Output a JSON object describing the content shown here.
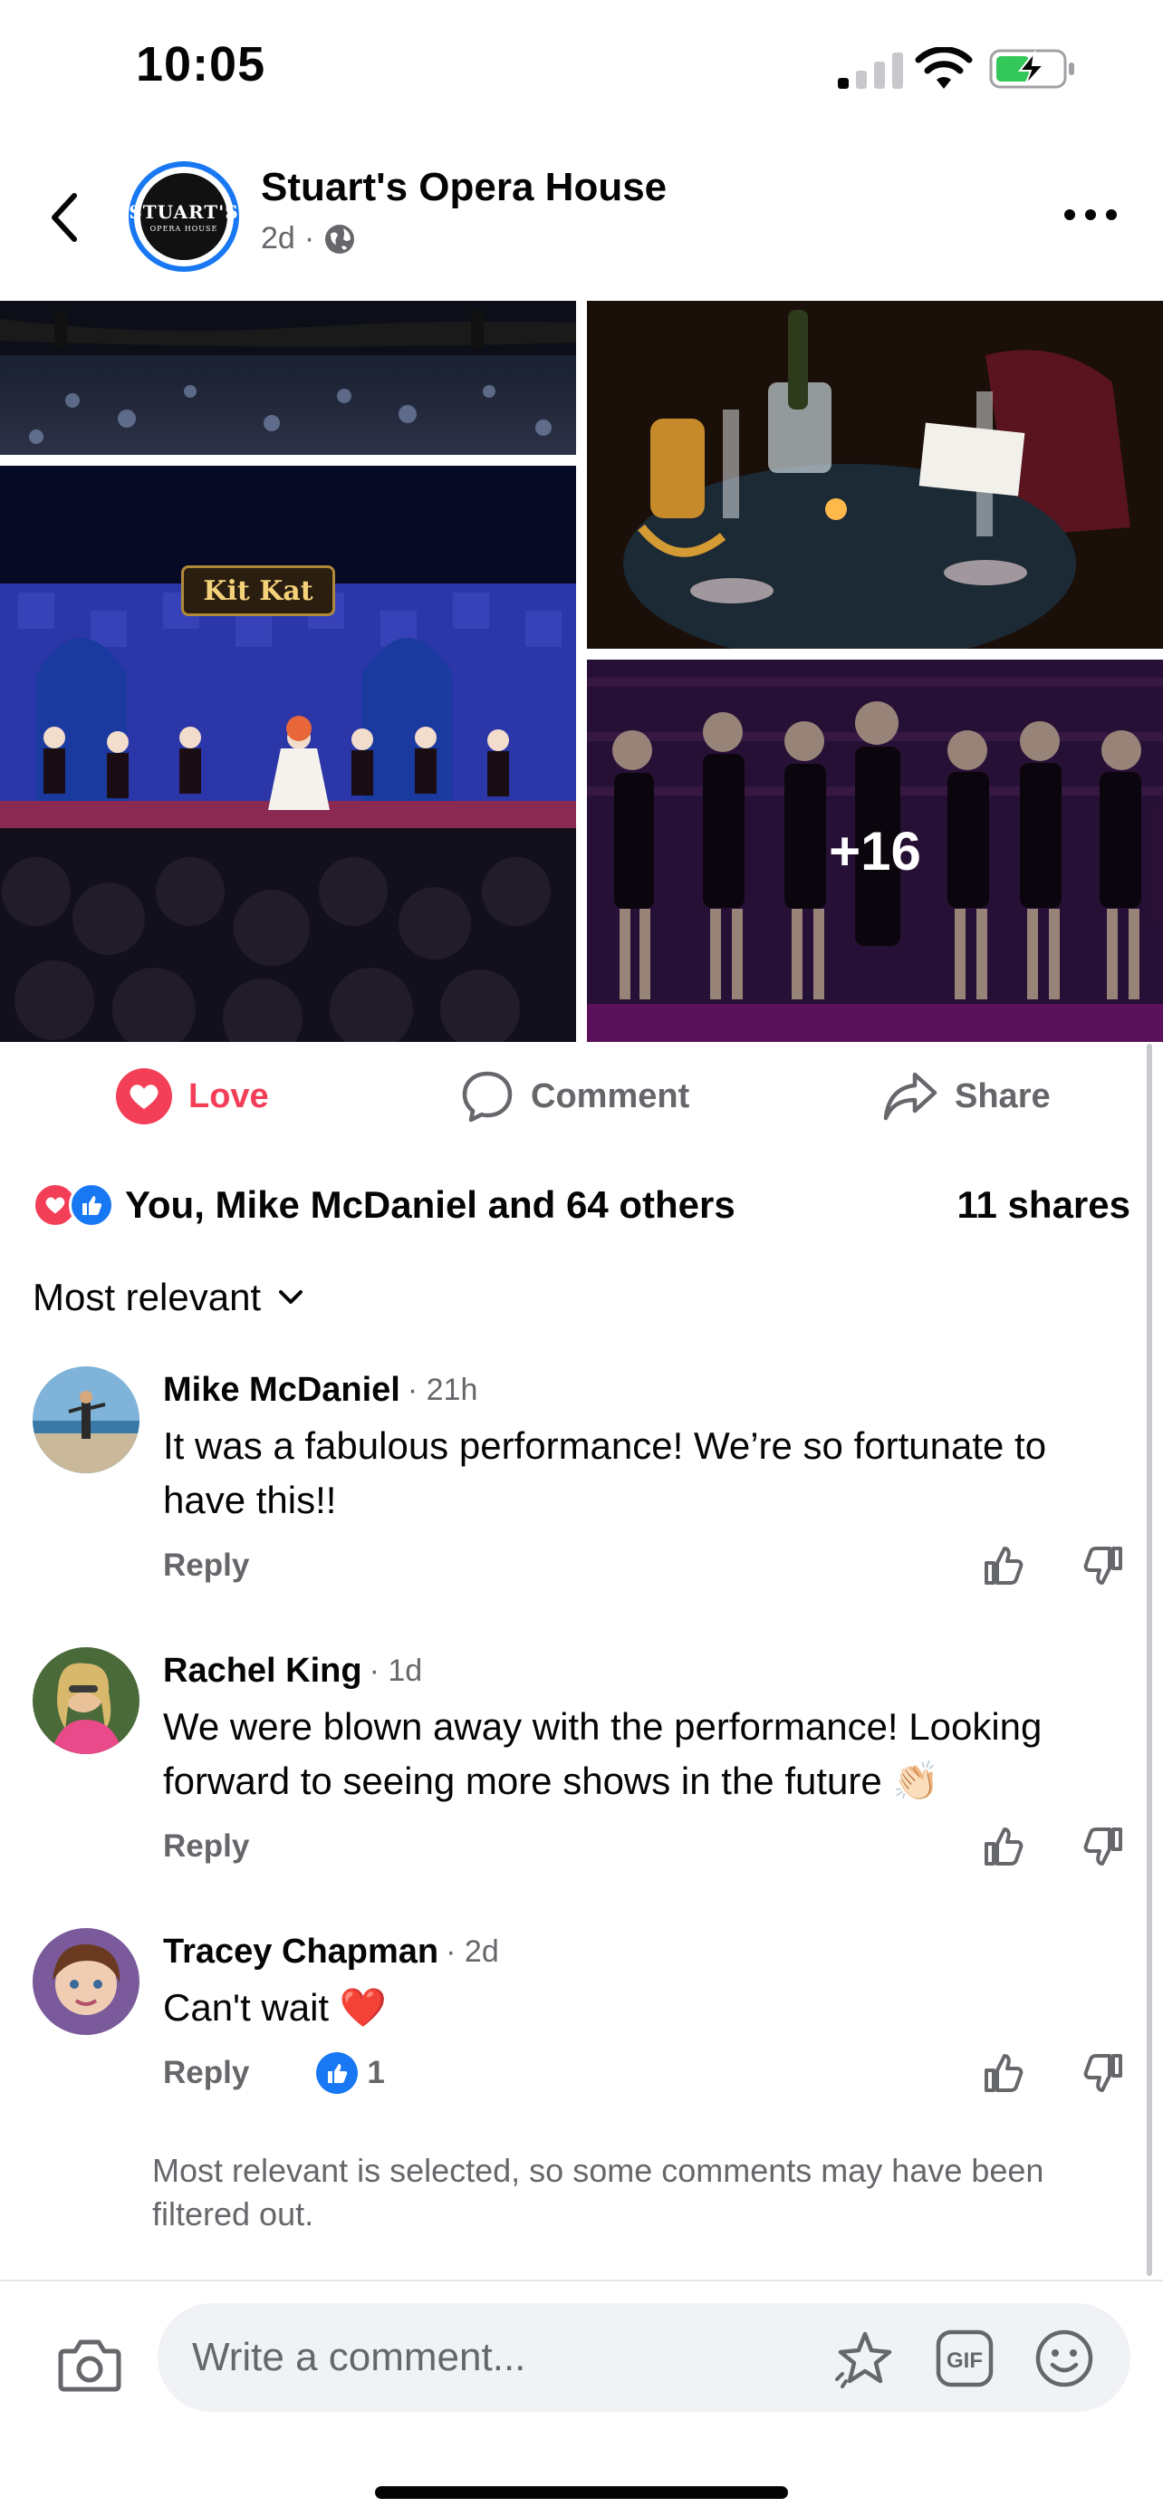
{
  "status_bar": {
    "time": "10:05"
  },
  "header": {
    "page_name": "Stuart's Opera House",
    "post_age": "2d",
    "separator": "·",
    "avatar_text_line1": "STUART'S",
    "avatar_text_line2": "OPERA HOUSE"
  },
  "photos": {
    "sign_text": "Kit Kat",
    "more_count": "+16"
  },
  "actions": {
    "love": "Love",
    "comment": "Comment",
    "share": "Share"
  },
  "reactions": {
    "summary": "You, Mike McDaniel and 64 others",
    "shares": "11 shares"
  },
  "sort": {
    "label": "Most relevant"
  },
  "comments": [
    {
      "author": "Mike McDaniel",
      "time": "· 21h",
      "text": "It was a fabulous performance! We’re so fortunate to have this!!",
      "reply": "Reply"
    },
    {
      "author": "Rachel King",
      "time": "· 1d",
      "text": "We were blown away with the performance! Looking forward to seeing more shows in the future 👏🏻",
      "reply": "Reply"
    },
    {
      "author": "Tracey Chapman",
      "time": "· 2d",
      "text": "Can't wait ❤️",
      "reply": "Reply",
      "like_count": "1"
    }
  ],
  "filter_note": "Most relevant is selected, so some comments may have been filtered out.",
  "composer": {
    "placeholder": "Write a comment...",
    "gif_label": "GIF"
  },
  "colors": {
    "accent": "#1877f2",
    "love": "#f33e58",
    "secondary_text": "#65676b"
  }
}
